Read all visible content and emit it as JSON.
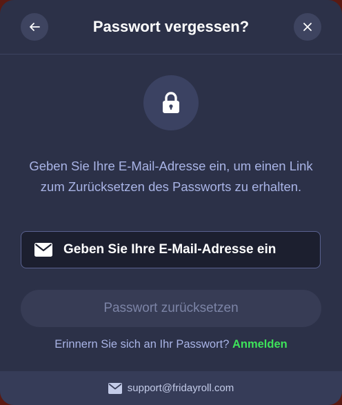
{
  "dialog": {
    "title": "Passwort vergessen?",
    "description": "Geben Sie Ihre E-Mail-Adresse ein, um einen Link zum Zurücksetzen des Passworts zu erhalten.",
    "email_placeholder": "Geben Sie Ihre E-Mail-Adresse ein",
    "email_value": "",
    "reset_button_label": "Passwort zurücksetzen",
    "remember_text": "Erinnern Sie sich an Ihr Passwort?",
    "login_link_label": "Anmelden"
  },
  "footer": {
    "support_email": "support@fridayroll.com"
  },
  "icons": {
    "back": "arrow-left-icon",
    "close": "close-icon",
    "lock": "lock-icon",
    "mail": "mail-icon"
  },
  "colors": {
    "modal_background": "#2c3148",
    "accent_link": "#3ee35a",
    "text_muted": "#a9b4e6"
  }
}
